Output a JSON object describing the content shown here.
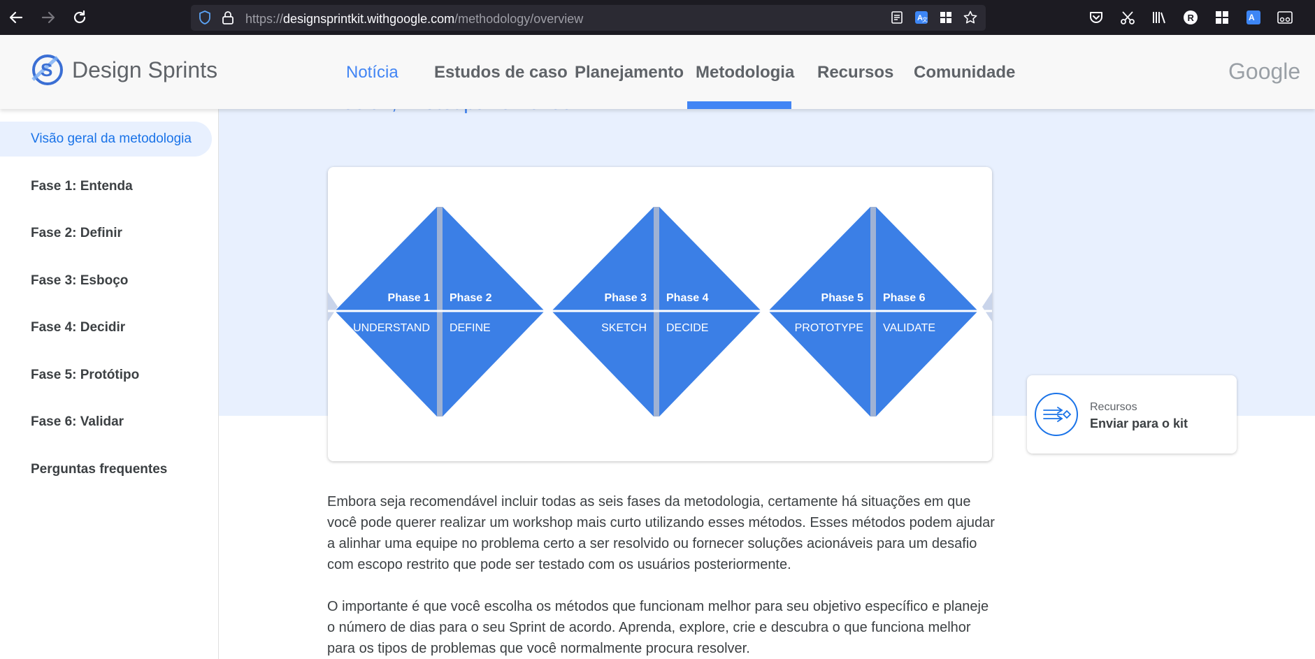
{
  "browser": {
    "url_prefix": "https://",
    "url_host": "designsprintkit.withgoogle.com",
    "url_path": "/methodology/overview"
  },
  "header": {
    "brand": "Design Sprints",
    "nav": [
      "Notícia",
      "Estudos de caso",
      "Planejamento",
      "Metodologia",
      "Recursos",
      "Comunidade"
    ],
    "active_tab": "Metodologia",
    "google": "Google"
  },
  "sidebar": {
    "items": [
      {
        "label": "Visão geral da metodologia"
      },
      {
        "label": "Fase 1: Entenda"
      },
      {
        "label": "Fase 2: Definir"
      },
      {
        "label": "Fase 3: Esboço"
      },
      {
        "label": "Fase 4: Decidir"
      },
      {
        "label": "Fase 5: Protótipo"
      },
      {
        "label": "Fase 6: Validar"
      },
      {
        "label": "Perguntas frequentes"
      }
    ]
  },
  "main": {
    "cut_heading": "Decidir, Prototipar e Validar.",
    "phases": [
      {
        "phase": "Phase 1",
        "name": "UNDERSTAND"
      },
      {
        "phase": "Phase 2",
        "name": "DEFINE"
      },
      {
        "phase": "Phase 3",
        "name": "SKETCH"
      },
      {
        "phase": "Phase 4",
        "name": "DECIDE"
      },
      {
        "phase": "Phase 5",
        "name": "PROTOTYPE"
      },
      {
        "phase": "Phase 6",
        "name": "VALIDATE"
      }
    ],
    "paragraph1": "Embora seja recomendável incluir todas as seis fases da metodologia, certamente há situações em que você pode querer realizar um workshop mais curto utilizando esses métodos. Esses métodos podem ajudar a alinhar uma equipe no problema certo a ser resolvido ou fornecer soluções acionáveis para um desafio com escopo restrito que pode ser testado com os usuários posteriormente.",
    "paragraph2": "O importante é que você escolha os métodos que funcionam melhor para seu objetivo específico e planeje o número de dias para o seu Sprint de acordo. Aprenda, explore, crie e descubra o que funciona melhor para os tipos de problemas que você normalmente procura resolver."
  },
  "resource_card": {
    "label": "Recursos",
    "title": "Enviar para o kit"
  },
  "colors": {
    "accent": "#4285f4",
    "diamond": "#3b7fe6",
    "band": "#e8f0fe"
  }
}
